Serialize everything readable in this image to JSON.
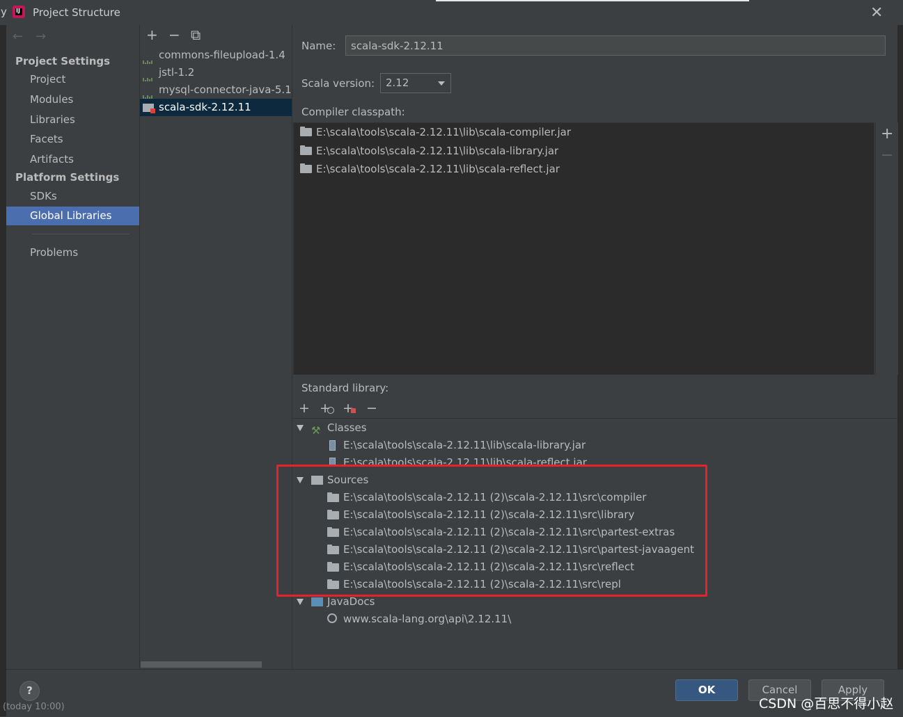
{
  "window": {
    "title": "Project Structure",
    "edge_letter": "y",
    "logo_text": "IJ"
  },
  "toolbar": {
    "back": "←",
    "forward": "→",
    "add": "+",
    "remove": "−",
    "copy": "⧉"
  },
  "sidebar": {
    "project_settings": "Project Settings",
    "platform_settings": "Platform Settings",
    "items": [
      {
        "label": "Project"
      },
      {
        "label": "Modules"
      },
      {
        "label": "Libraries"
      },
      {
        "label": "Facets"
      },
      {
        "label": "Artifacts"
      },
      {
        "label": "SDKs"
      },
      {
        "label": "Global Libraries"
      },
      {
        "label": "Problems"
      }
    ]
  },
  "libraries": [
    {
      "label": "commons-fileupload-1.4"
    },
    {
      "label": "jstl-1.2"
    },
    {
      "label": "mysql-connector-java-5.1."
    },
    {
      "label": "scala-sdk-2.12.11",
      "selected": true
    }
  ],
  "details": {
    "name_label": "Name:",
    "name_value": "scala-sdk-2.12.11",
    "scala_version_label": "Scala version:",
    "scala_version_value": "2.12",
    "compiler_classpath_label": "Compiler classpath:",
    "compiler_classpath": [
      "E:\\scala\\tools\\scala-2.12.11\\lib\\scala-compiler.jar",
      "E:\\scala\\tools\\scala-2.12.11\\lib\\scala-library.jar",
      "E:\\scala\\tools\\scala-2.12.11\\lib\\scala-reflect.jar"
    ],
    "side_add": "+",
    "side_remove": "−",
    "standard_library_label": "Standard library:"
  },
  "std_toolbar": {
    "add": "+",
    "add_special": "+",
    "add_excluded": "+",
    "remove": "−"
  },
  "tree": {
    "classes_label": "Classes",
    "classes": [
      "E:\\scala\\tools\\scala-2.12.11\\lib\\scala-library.jar",
      "E:\\scala\\tools\\scala-2.12.11\\lib\\scala-reflect.jar"
    ],
    "sources_label": "Sources",
    "sources": [
      "E:\\scala\\tools\\scala-2.12.11 (2)\\scala-2.12.11\\src\\compiler",
      "E:\\scala\\tools\\scala-2.12.11 (2)\\scala-2.12.11\\src\\library",
      "E:\\scala\\tools\\scala-2.12.11 (2)\\scala-2.12.11\\src\\partest-extras",
      "E:\\scala\\tools\\scala-2.12.11 (2)\\scala-2.12.11\\src\\partest-javaagent",
      "E:\\scala\\tools\\scala-2.12.11 (2)\\scala-2.12.11\\src\\reflect",
      "E:\\scala\\tools\\scala-2.12.11 (2)\\scala-2.12.11\\src\\repl"
    ],
    "javadocs_label": "JavaDocs",
    "javadocs": [
      "www.scala-lang.org\\api\\2.12.11\\"
    ]
  },
  "buttons": {
    "help": "?",
    "ok": "OK",
    "cancel": "Cancel",
    "apply": "Apply"
  },
  "watermark": "CSDN @百思不得小赵",
  "footer_ghost": "(today 10:00)",
  "colors": {
    "background": "#3c3f41",
    "selection": "#4b6eaf",
    "list_selection": "#0d293e",
    "highlight_border": "#e8212b",
    "primary_button": "#365880"
  }
}
